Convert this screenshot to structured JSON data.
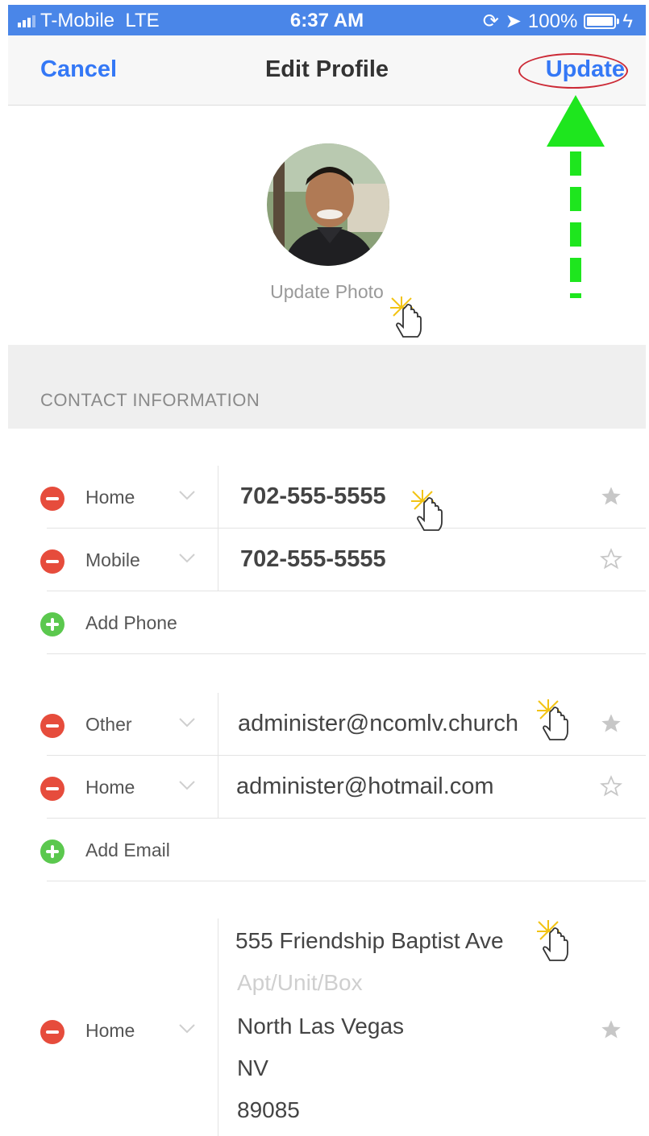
{
  "status_bar": {
    "carrier": "T-Mobile",
    "network": "LTE",
    "time": "6:37 AM",
    "battery": "100%"
  },
  "nav": {
    "cancel_label": "Cancel",
    "title": "Edit Profile",
    "update_label": "Update"
  },
  "photo": {
    "update_label": "Update Photo"
  },
  "section": {
    "contact_header": "CONTACT INFORMATION"
  },
  "phones": [
    {
      "type": "Home",
      "value": "702-555-5555",
      "favorite": true
    },
    {
      "type": "Mobile",
      "value": "702-555-5555",
      "favorite": false
    }
  ],
  "add_phone_label": "Add Phone",
  "emails": [
    {
      "type": "Other",
      "value": "administer@ncomlv.church",
      "favorite": true
    },
    {
      "type": "Home",
      "value": "administer@hotmail.com",
      "favorite": false
    }
  ],
  "add_email_label": "Add Email",
  "address": {
    "type": "Home",
    "street": "555 Friendship Baptist Ave",
    "apt_placeholder": "Apt/Unit/Box",
    "city": "North Las Vegas",
    "state": "NV",
    "zip": "89085",
    "favorite": true
  },
  "colors": {
    "status_bar": "#4a86e8",
    "link_blue": "#3478f6",
    "remove_red": "#e64c3c",
    "add_green": "#5bc84e",
    "annotation_arrow": "#1ee61e",
    "annotation_ring": "#cc2a36"
  }
}
